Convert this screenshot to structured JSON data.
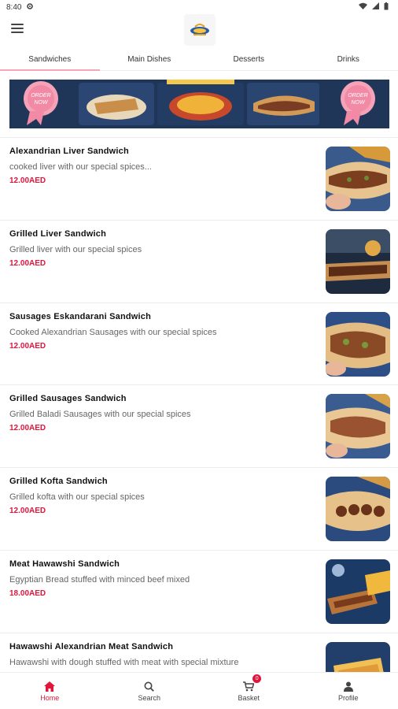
{
  "status_bar": {
    "time": "8:40"
  },
  "header": {
    "logo_alt": "logo"
  },
  "tabs": [
    {
      "label": "Sandwiches",
      "active": true
    },
    {
      "label": "Main Dishes",
      "active": false
    },
    {
      "label": "Desserts",
      "active": false
    },
    {
      "label": "Drinks",
      "active": false
    }
  ],
  "banner": {
    "badge_text": "ORDER NOW"
  },
  "items": [
    {
      "name": "Alexandrian Liver Sandwich",
      "description": "cooked liver with our special spices...",
      "price": "12.00AED"
    },
    {
      "name": "Grilled Liver Sandwich",
      "description": "Grilled liver with our special spices",
      "price": "12.00AED"
    },
    {
      "name": "Sausages Eskandarani Sandwich",
      "description": "Cooked Alexandrian Sausages with our special spices",
      "price": "12.00AED"
    },
    {
      "name": "Grilled Sausages Sandwich",
      "description": "Grilled Baladi Sausages with our special spices",
      "price": "12.00AED"
    },
    {
      "name": "Grilled Kofta Sandwich",
      "description": "Grilled kofta with our special spices",
      "price": "12.00AED"
    },
    {
      "name": "Meat Hawawshi Sandwich",
      "description": "Egyptian Bread stuffed with minced beef mixed",
      "price": "18.00AED"
    },
    {
      "name": "Hawawshi Alexandrian Meat Sandwich",
      "description": "Hawawshi with dough stuffed with meat with special mixture",
      "price": ""
    }
  ],
  "bottom_nav": {
    "home": "Home",
    "search": "Search",
    "basket": "Basket",
    "basket_count": "0",
    "profile": "Profile"
  },
  "colors": {
    "accent": "#e0163c",
    "tab_indicator": "#f8a5b5",
    "banner_bg": "#1f3658"
  }
}
